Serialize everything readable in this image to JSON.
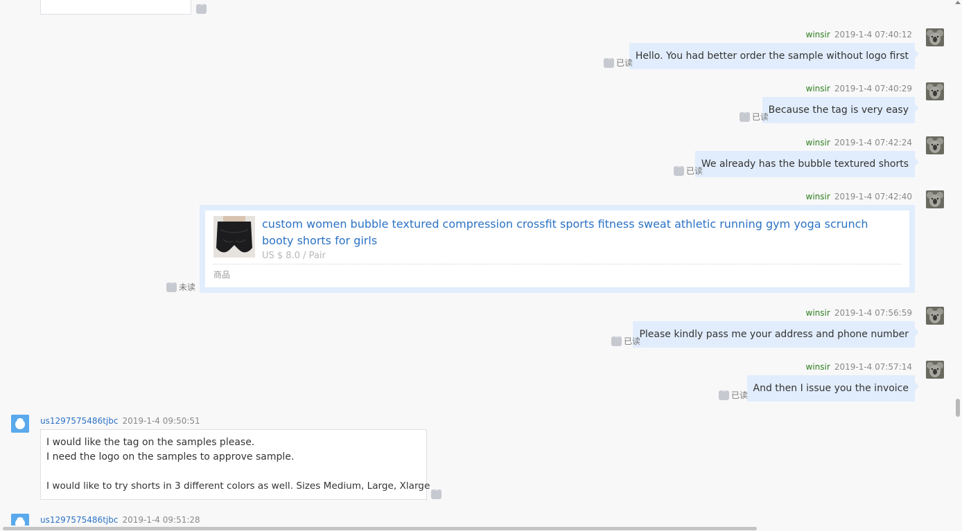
{
  "messages_out": [
    {
      "sender": "winsir",
      "time": "2019-1-4 07:40:12",
      "text": "Hello. You had better order the sample without logo first",
      "status": "已读"
    },
    {
      "sender": "winsir",
      "time": "2019-1-4 07:40:29",
      "text": "Because the tag is very easy",
      "status": "已读"
    },
    {
      "sender": "winsir",
      "time": "2019-1-4 07:42:24",
      "text": "We already has the bubble textured shorts",
      "status": "已读"
    }
  ],
  "product_message": {
    "sender": "winsir",
    "time": "2019-1-4 07:42:40",
    "status": "未读",
    "title": "custom women bubble textured compression crossfit sports fitness sweat athletic running gym yoga scrunch booty shorts for girls",
    "price": "US $ 8.0 / Pair",
    "type_label": "商品"
  },
  "messages_out_2": [
    {
      "sender": "winsir",
      "time": "2019-1-4 07:56:59",
      "text": "Please kindly pass me your address and phone number",
      "status": "已读"
    },
    {
      "sender": "winsir",
      "time": "2019-1-4 07:57:14",
      "text": "And then I issue you the invoice",
      "status": "已读"
    }
  ],
  "buyer_message": {
    "sender": "us1297575486tjbc",
    "time": "2019-1-4 09:50:51",
    "line1": "I would like the tag on the samples please.",
    "line2": "I need the logo on the samples to approve sample.",
    "line3": "I would like to try shorts in 3 different colors as well. Sizes Medium, Large, Xlarge"
  },
  "buyer_message_2": {
    "sender": "us1297575486tjbc",
    "time": "2019-1-4 09:51:28"
  }
}
